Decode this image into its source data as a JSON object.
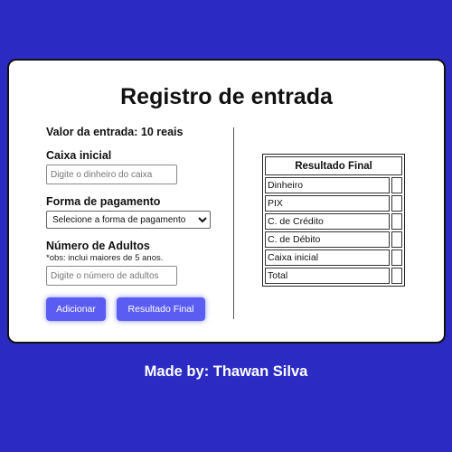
{
  "title": "Registro de entrada",
  "entrada_text": "Valor da entrada: 10 reais",
  "caixa": {
    "label": "Caixa inicial",
    "placeholder": "Digite o dinheiro do caixa"
  },
  "pagamento": {
    "label": "Forma de pagamento",
    "selected": "Selecione a forma de pagamento"
  },
  "adultos": {
    "label": "Número de Adultos",
    "note": "*obs: inclui maiores de 5 anos.",
    "placeholder": "Digite o número de adultos"
  },
  "buttons": {
    "add": "Adicionar",
    "result": "Resultado Final"
  },
  "table": {
    "header": "Resultado Final",
    "rows": [
      "Dinheiro",
      "PIX",
      "C. de Crédito",
      "C. de Débito",
      "Caixa inicial",
      "Total"
    ]
  },
  "footer": "Made by: Thawan Silva",
  "colors": {
    "background": "#2b2bc4",
    "button": "#5a5cf2",
    "card": "#ffffff"
  }
}
